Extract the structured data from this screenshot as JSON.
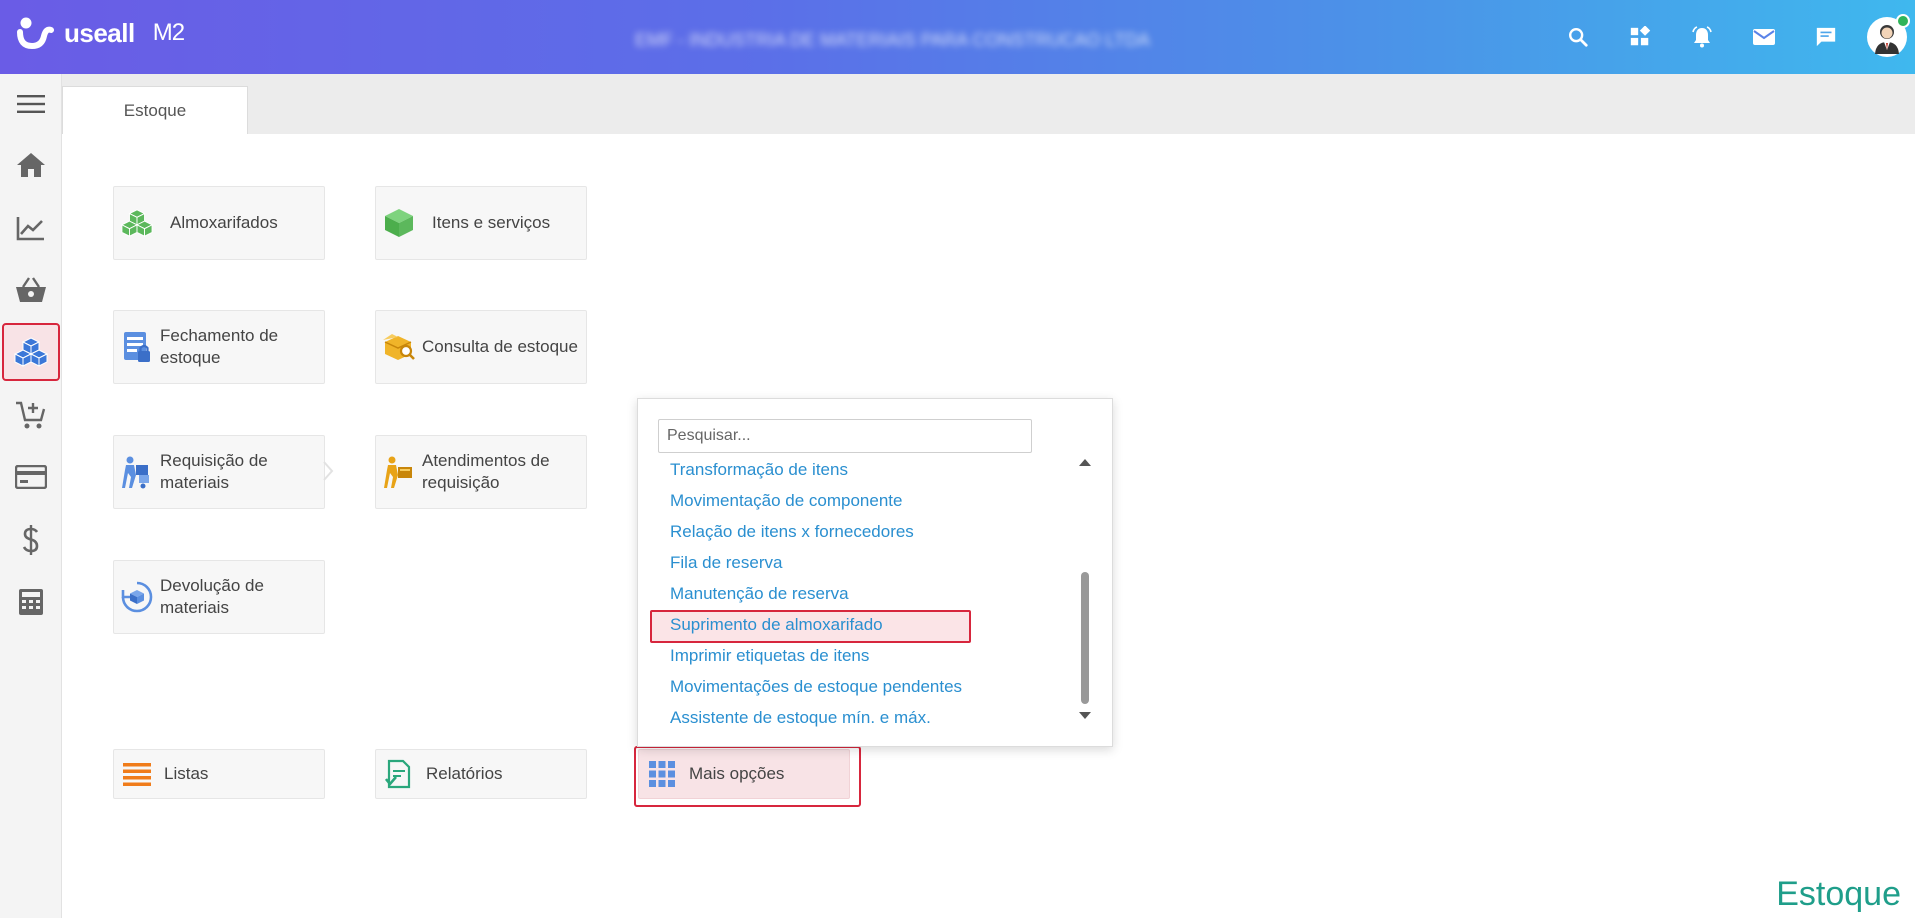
{
  "header": {
    "logo_text": "useall",
    "logo_version": "M2",
    "company_name": "EMF - INDUSTRIA DE MATERIAIS PARA CONSTRUCAO LTDA",
    "icons": [
      "search-icon",
      "widgets-icon",
      "alarm-bell-icon",
      "mail-icon",
      "chat-icon",
      "user-avatar"
    ],
    "avatar_status_color": "#2fb45a"
  },
  "sidebar": {
    "items": [
      "menu-icon",
      "home-icon",
      "trending-chart-icon",
      "basket-icon",
      "boxes-icon",
      "cart-add-icon",
      "credit-card-icon",
      "dollar-icon",
      "calculator-icon"
    ],
    "active_index": 4
  },
  "tabs": [
    {
      "label": "Estoque"
    }
  ],
  "tiles": [
    {
      "label": "Almoxarifados",
      "icon": "cubes-icon"
    },
    {
      "label": "Itens e serviços",
      "icon": "box-icon"
    },
    {
      "label": "Fechamento de estoque",
      "icon": "lock-document-icon"
    },
    {
      "label": "Consulta de estoque",
      "icon": "box-search-icon"
    },
    {
      "label": "Requisição de materiais",
      "icon": "hand-truck-icon"
    },
    {
      "label": "Atendimentos de requisição",
      "icon": "delivery-person-icon"
    },
    {
      "label": "Devolução de materiais",
      "icon": "return-box-icon"
    },
    {
      "label": "Listas",
      "icon": "list-icon"
    },
    {
      "label": "Relatórios",
      "icon": "report-icon"
    },
    {
      "label": "Mais opções",
      "icon": "grid-icon"
    }
  ],
  "dropdown": {
    "search_placeholder": "Pesquisar...",
    "items": [
      "Transformação de itens",
      "Movimentação de componente",
      "Relação de itens x fornecedores",
      "Fila de reserva",
      "Manutenção de reserva",
      "Suprimento de almoxarifado",
      "Imprimir etiquetas de itens",
      "Movimentações de estoque pendentes",
      "Assistente de estoque mín. e máx."
    ],
    "selected_index": 5
  },
  "footer": {
    "title": "Estoque"
  },
  "colors": {
    "accent_red": "#d7263d",
    "link_blue": "#2a8fd0",
    "footer_teal": "#1f9e8a"
  }
}
